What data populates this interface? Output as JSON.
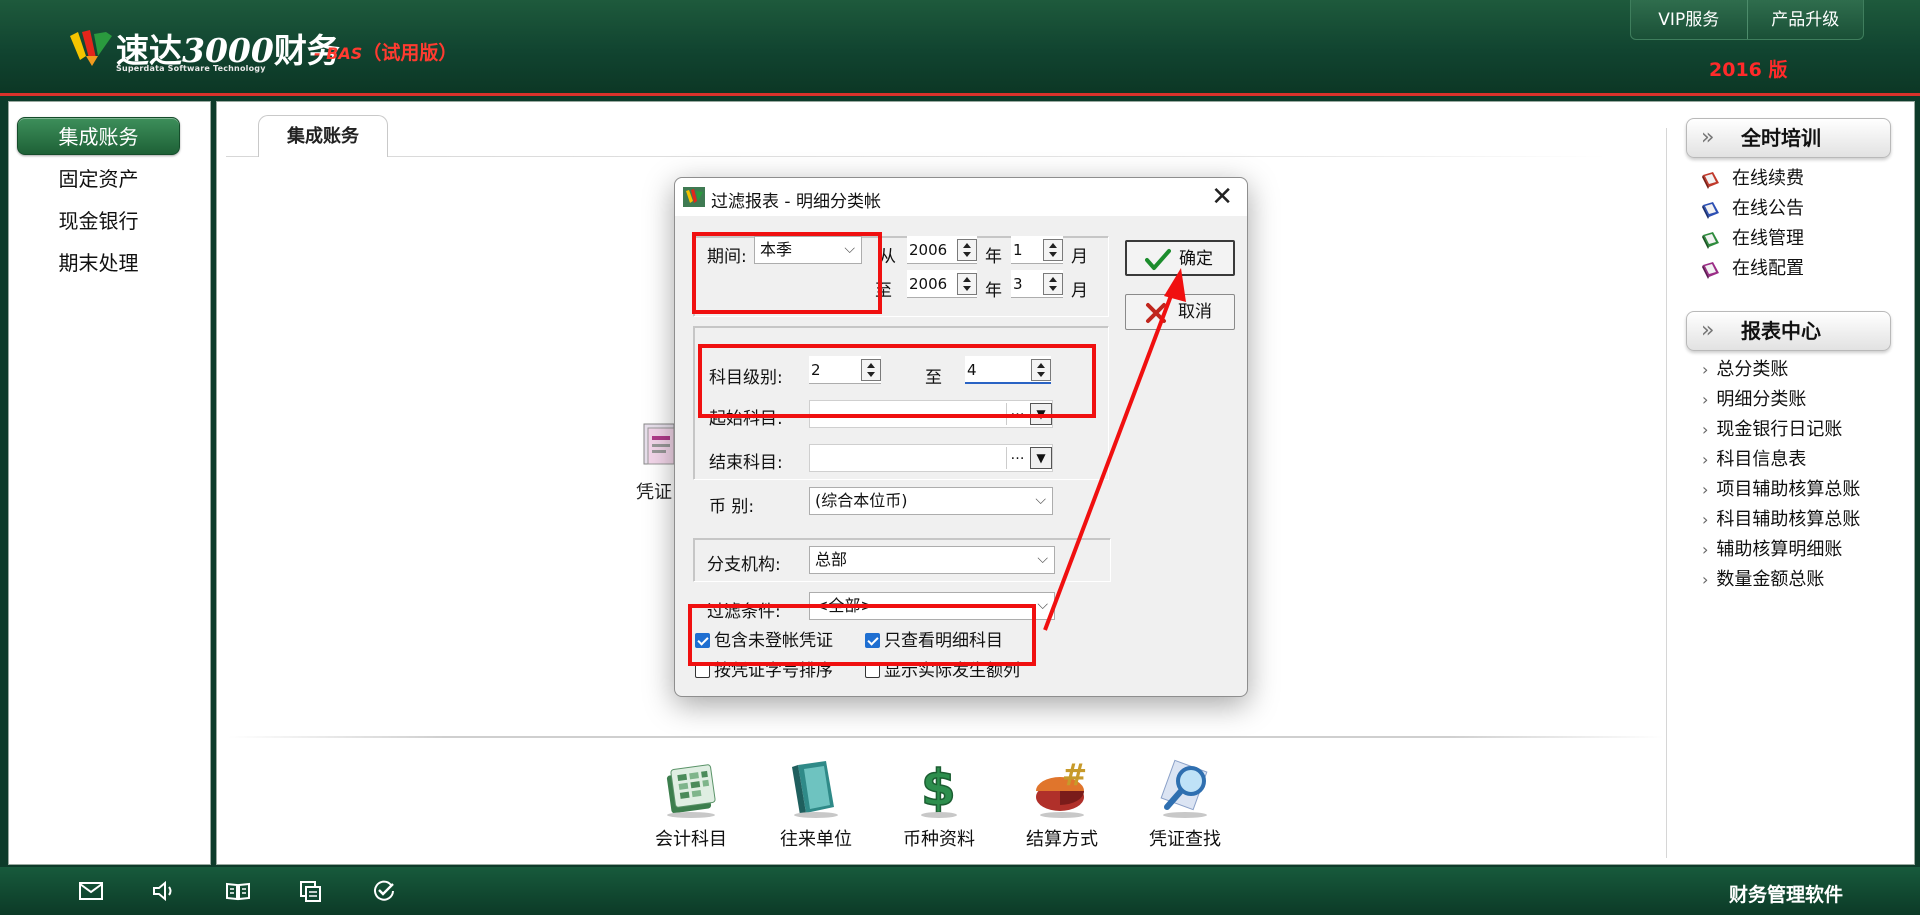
{
  "header": {
    "logo_main": "速达",
    "logo_num": "3000",
    "logo_fin": "财务",
    "logo_suffix_bas": " - BAS",
    "logo_suffix_trial": "（试用版）",
    "logo_sub": "Superdata Software Technology",
    "vip_label": "VIP服务",
    "upgrade_label": "产品升级",
    "edition": "2016 版"
  },
  "sidebar": {
    "items": [
      {
        "label": "集成账务",
        "active": true
      },
      {
        "label": "固定资产"
      },
      {
        "label": "现金银行"
      },
      {
        "label": "期末处理"
      }
    ]
  },
  "main": {
    "tab_label": "集成账务",
    "bg_voucher_label": "凭证",
    "tools": [
      {
        "label": "会计科目",
        "icon": "accounts-icon"
      },
      {
        "label": "往来单位",
        "icon": "contacts-icon"
      },
      {
        "label": "币种资料",
        "icon": "currency-icon"
      },
      {
        "label": "结算方式",
        "icon": "settlement-icon"
      },
      {
        "label": "凭证查找",
        "icon": "voucher-search-icon"
      }
    ]
  },
  "right_panel": {
    "training_title": "全时培训",
    "online_items": [
      {
        "label": "在线续费",
        "color": "#c0392b"
      },
      {
        "label": "在线公告",
        "color": "#2c4fb3"
      },
      {
        "label": "在线管理",
        "color": "#2e8b3d"
      },
      {
        "label": "在线配置",
        "color": "#9b2c86"
      }
    ],
    "report_title": "报表中心",
    "report_items": [
      "总分类账",
      "明细分类账",
      "现金银行日记账",
      "科目信息表",
      "项目辅助核算总账",
      "科目辅助核算总账",
      "辅助核算明细账",
      "数量金额总账"
    ]
  },
  "footer": {
    "text": "财务管理软件"
  },
  "dialog": {
    "title": "过滤报表 - 明细分类帐",
    "period_label": "期间:",
    "period_value": "本季",
    "from_label": "从",
    "to_label": "至",
    "year_label": "年",
    "month_label": "月",
    "from_year": "2006",
    "from_month": "1",
    "to_year": "2006",
    "to_month": "3",
    "level_label": "科目级别:",
    "level_from": "2",
    "level_to_label": "至",
    "level_to": "4",
    "start_subject_label": "起始科目:",
    "end_subject_label": "结束科目:",
    "currency_label": "币 别:",
    "currency_value": "(综合本位币)",
    "branch_label": "分支机构:",
    "branch_value": "总部",
    "filter_label": "过滤条件:",
    "filter_value": "<全部>",
    "ok_label": "确定",
    "cancel_label": "取消",
    "checks": [
      {
        "label": "包含未登帐凭证",
        "checked": true
      },
      {
        "label": "只查看明细科目",
        "checked": true
      },
      {
        "label": "按凭证字号排序",
        "checked": false
      },
      {
        "label": "显示实际发生额列",
        "checked": false
      }
    ]
  },
  "colors": {
    "header_green": "#114430",
    "accent_red": "#f01010",
    "checkbox_blue": "#1f6fd1"
  }
}
